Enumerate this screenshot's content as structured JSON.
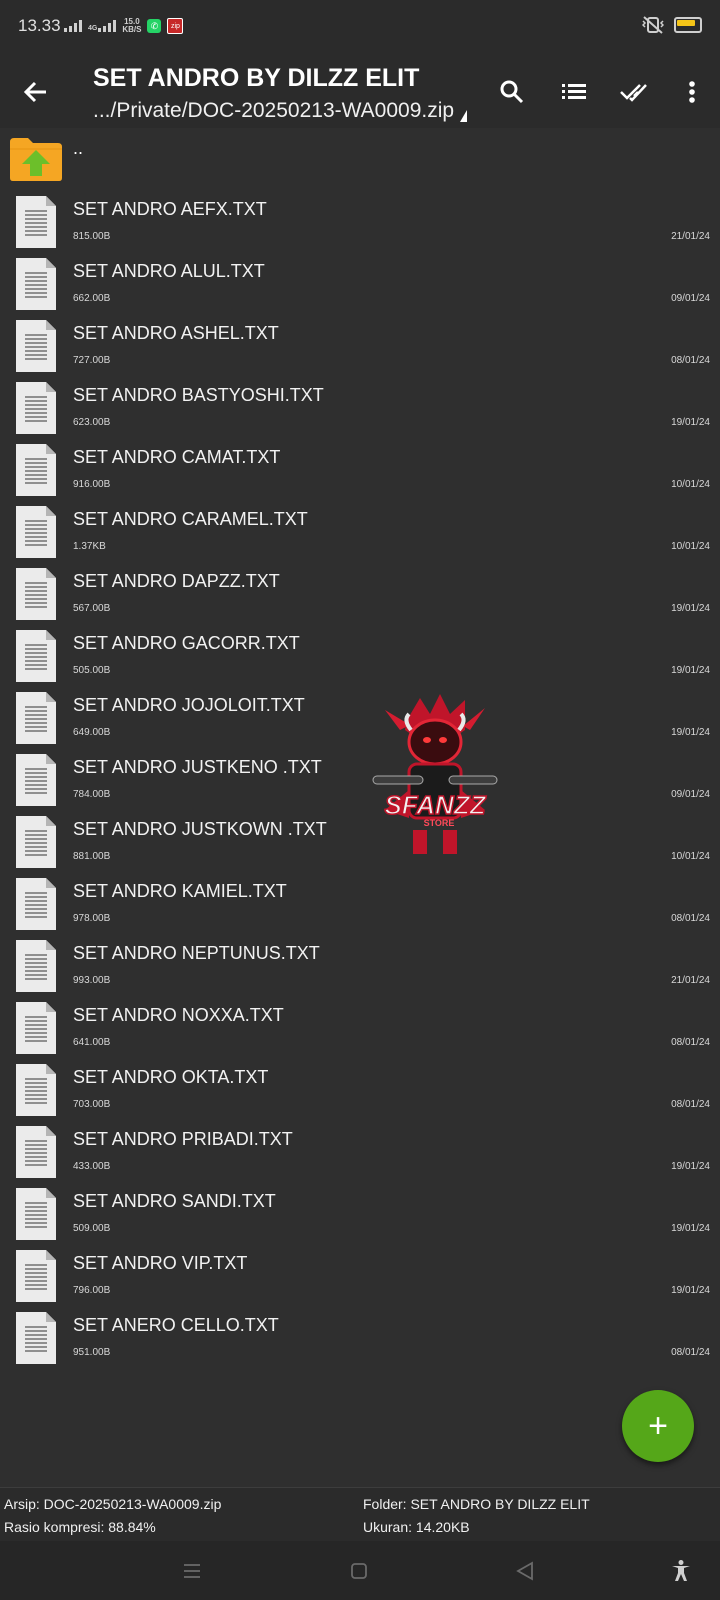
{
  "status_bar": {
    "time": "13.33",
    "net_speed_top": "15.0",
    "net_speed_bottom": "KB/S",
    "network_label": "4G",
    "icons": [
      "signal-icon",
      "whatsapp-icon",
      "zip-app-icon",
      "vibrate-off-icon",
      "battery-icon"
    ]
  },
  "toolbar": {
    "title": "SET ANDRO BY DILZZ ELIT",
    "subtitle": ".../Private/DOC-20250213-WA0009.zip",
    "actions": [
      "search-icon",
      "list-view-icon",
      "select-all-icon",
      "more-vert-icon"
    ]
  },
  "list": {
    "up_label": "..",
    "files": [
      {
        "name": "SET ANDRO AEFX.TXT",
        "size": "815.00B",
        "date": "21/01/24"
      },
      {
        "name": "SET ANDRO ALUL.TXT",
        "size": "662.00B",
        "date": "09/01/24"
      },
      {
        "name": "SET ANDRO ASHEL.TXT",
        "size": "727.00B",
        "date": "08/01/24"
      },
      {
        "name": "SET ANDRO BASTYOSHI.TXT",
        "size": "623.00B",
        "date": "19/01/24"
      },
      {
        "name": "SET ANDRO CAMAT.TXT",
        "size": "916.00B",
        "date": "10/01/24"
      },
      {
        "name": "SET ANDRO CARAMEL.TXT",
        "size": "1.37KB",
        "date": "10/01/24"
      },
      {
        "name": "SET ANDRO DAPZZ.TXT",
        "size": "567.00B",
        "date": "19/01/24"
      },
      {
        "name": "SET ANDRO GACORR.TXT",
        "size": "505.00B",
        "date": "19/01/24"
      },
      {
        "name": "SET ANDRO JOJOLOIT.TXT",
        "size": "649.00B",
        "date": "19/01/24"
      },
      {
        "name": "SET ANDRO JUSTKENO .TXT",
        "size": "784.00B",
        "date": "09/01/24"
      },
      {
        "name": "SET ANDRO JUSTKOWN .TXT",
        "size": "881.00B",
        "date": "10/01/24"
      },
      {
        "name": "SET ANDRO KAMIEL.TXT",
        "size": "978.00B",
        "date": "08/01/24"
      },
      {
        "name": "SET ANDRO NEPTUNUS.TXT",
        "size": "993.00B",
        "date": "21/01/24"
      },
      {
        "name": "SET ANDRO NOXXA.TXT",
        "size": "641.00B",
        "date": "08/01/24"
      },
      {
        "name": "SET ANDRO OKTA.TXT",
        "size": "703.00B",
        "date": "08/01/24"
      },
      {
        "name": "SET ANDRO PRIBADI.TXT",
        "size": "433.00B",
        "date": "19/01/24"
      },
      {
        "name": "SET ANDRO SANDI.TXT",
        "size": "509.00B",
        "date": "19/01/24"
      },
      {
        "name": "SET ANDRO VIP.TXT",
        "size": "796.00B",
        "date": "19/01/24"
      },
      {
        "name": "SET ANERO CELLO.TXT",
        "size": "951.00B",
        "date": "08/01/24"
      }
    ]
  },
  "watermark": {
    "text": "SFANZZ",
    "subtext": "STORE"
  },
  "fab": {
    "icon": "add-icon",
    "label": "+"
  },
  "footer": {
    "archive": "Arsip: DOC-20250213-WA0009.zip",
    "ratio": "Rasio kompresi: 88.84%",
    "folder": "Folder: SET ANDRO BY DILZZ ELIT",
    "size": "Ukuran: 14.20KB"
  },
  "nav_bar": {
    "icons": [
      "recents-icon",
      "home-icon",
      "back-triangle-icon",
      "accessibility-icon"
    ]
  },
  "colors": {
    "background": "#2f2f2f",
    "toolbar": "#2b2b2b",
    "fab": "#55a719",
    "folder": "#f5a623",
    "arrow": "#6cbf2a"
  }
}
